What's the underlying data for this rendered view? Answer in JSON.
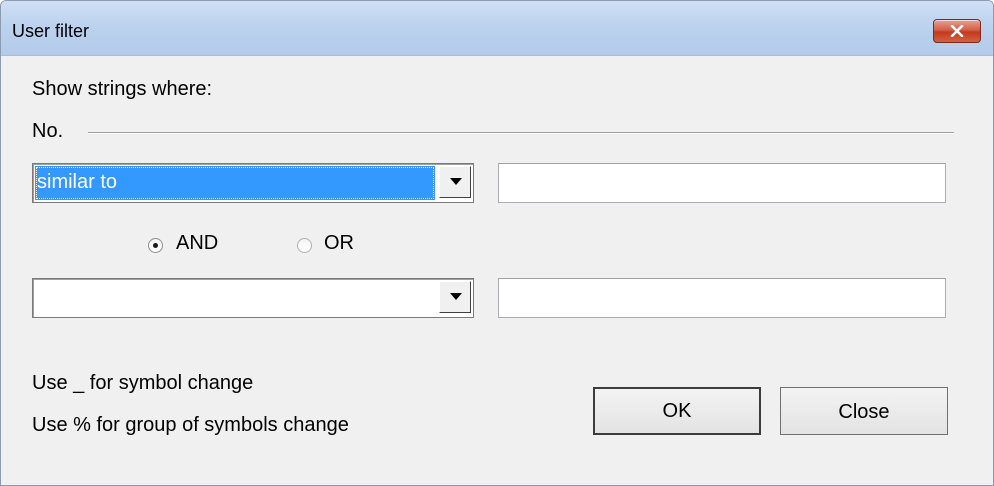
{
  "window": {
    "title": "User filter",
    "close_icon": "close-x-icon"
  },
  "filter": {
    "heading": "Show strings where:",
    "field_name": "No.",
    "condition1": {
      "operator": "similar to",
      "value": ""
    },
    "logic": {
      "and_label": "AND",
      "or_label": "OR",
      "selected": "AND"
    },
    "condition2": {
      "operator": "",
      "value": ""
    }
  },
  "hints": {
    "line1": "Use _ for symbol change",
    "line2": "Use % for group of symbols change"
  },
  "buttons": {
    "ok_label": "OK",
    "close_label": "Close"
  },
  "colors": {
    "selection": "#3399ff",
    "titlebar": "#bcd2ee",
    "close_button": "#c23a1f"
  }
}
